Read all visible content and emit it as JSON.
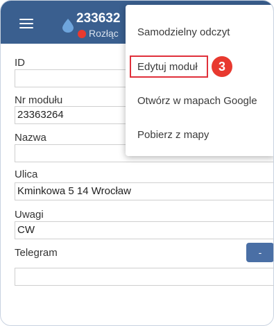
{
  "header": {
    "title": "233632",
    "status": "Rozłąc"
  },
  "form": {
    "id_label": "ID",
    "id_value": "",
    "module_no_label": "Nr modułu",
    "module_no_value": "23363264",
    "name_label": "Nazwa",
    "name_value": "",
    "street_label": "Ulica",
    "street_value": "Kminkowa 5 14 Wrocław",
    "notes_label": "Uwagi",
    "notes_value": "CW",
    "telegram_label": "Telegram",
    "telegram_button": "-",
    "telegram_value": ""
  },
  "menu": {
    "items": [
      {
        "label": "Samodzielny odczyt"
      },
      {
        "label": "Edytuj moduł"
      },
      {
        "label": "Otwórz w mapach Google"
      },
      {
        "label": "Pobierz z mapy"
      }
    ],
    "step_badge": "3"
  },
  "colors": {
    "header_bg": "#3a5f8f",
    "accent_red": "#e8392f",
    "button_blue": "#4a6fa5"
  },
  "icons": {
    "menu": "hamburger-icon",
    "water": "water-drop-icon",
    "status": "status-dot-icon"
  }
}
